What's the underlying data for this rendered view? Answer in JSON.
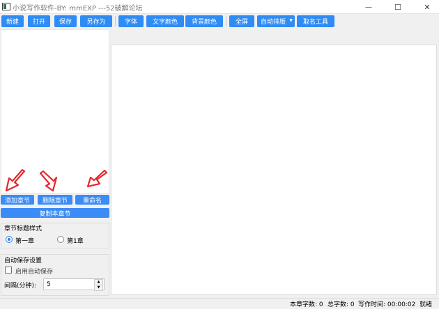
{
  "window": {
    "title": "小说写作软件-BY: mmEXP ---52破解论坛",
    "minimize_glyph": "—",
    "maximize_glyph": "☐",
    "close_glyph": "✕"
  },
  "toolbar": {
    "new": "新建",
    "open": "打开",
    "save": "保存",
    "save_as": "另存为",
    "font": "字体",
    "text_color": "文字颜色",
    "bg_color": "背景颜色",
    "fullscreen": "全屏",
    "auto_layout": "自动排版",
    "naming_tool": "取名工具"
  },
  "chapter_actions": {
    "add": "添加章节",
    "delete": "删除章节",
    "rename": "重命名",
    "copy": "复制本章节"
  },
  "title_style": {
    "label": "章节标题样式",
    "option1": "第一章",
    "option2": "第1章",
    "selected": "第一章"
  },
  "autosave": {
    "label": "自动保存设置",
    "enable_label": "启用自动保存",
    "enabled": false,
    "interval_label": "间隔(分钟):",
    "interval_value": "5"
  },
  "status": {
    "chapter_words": "本章字数: 0",
    "total_words": "总字数: 0",
    "write_time": "写作时间: 00:00:02",
    "state": "就绪"
  },
  "colors": {
    "accent": "#2f8cf5",
    "annotation_arrow": "#e8262d"
  },
  "annotations": {
    "arrows_count": 3
  }
}
